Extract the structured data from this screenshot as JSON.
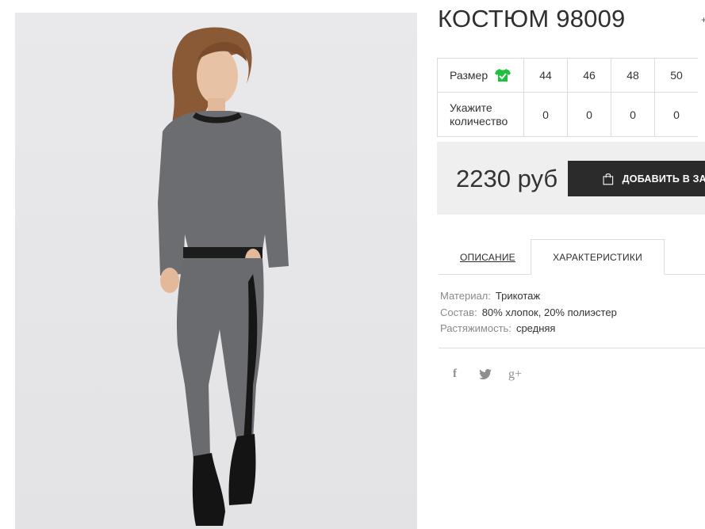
{
  "product": {
    "title": "КОСТЮМ 98009",
    "price": "2230 руб",
    "add_to_cart_label": "ДОБАВИТЬ В ЗАКАЗ",
    "image_alt": "model in grey knit suit"
  },
  "size_table": {
    "size_label": "Размер",
    "qty_label_line1": "Укажите",
    "qty_label_line2": "количество",
    "sizes": [
      "44",
      "46",
      "48",
      "50"
    ],
    "quantities": [
      "0",
      "0",
      "0",
      "0"
    ]
  },
  "tabs": {
    "description": "ОПИСАНИЕ",
    "characteristics": "ХАРАКТЕРИСТИКИ",
    "active": "characteristics"
  },
  "specs": [
    {
      "key": "Материал:",
      "value": "Трикотаж"
    },
    {
      "key": "Состав:",
      "value": "80% хлопок, 20% полиэстер"
    },
    {
      "key": "Растяжимость:",
      "value": "средняя"
    }
  ],
  "social": {
    "facebook": "f",
    "twitter": "twitter",
    "google_plus": "g+"
  },
  "colors": {
    "button_bg": "#2b2b2b",
    "price_panel_bg": "#efefef",
    "size_icon": "#1fbf3f"
  }
}
